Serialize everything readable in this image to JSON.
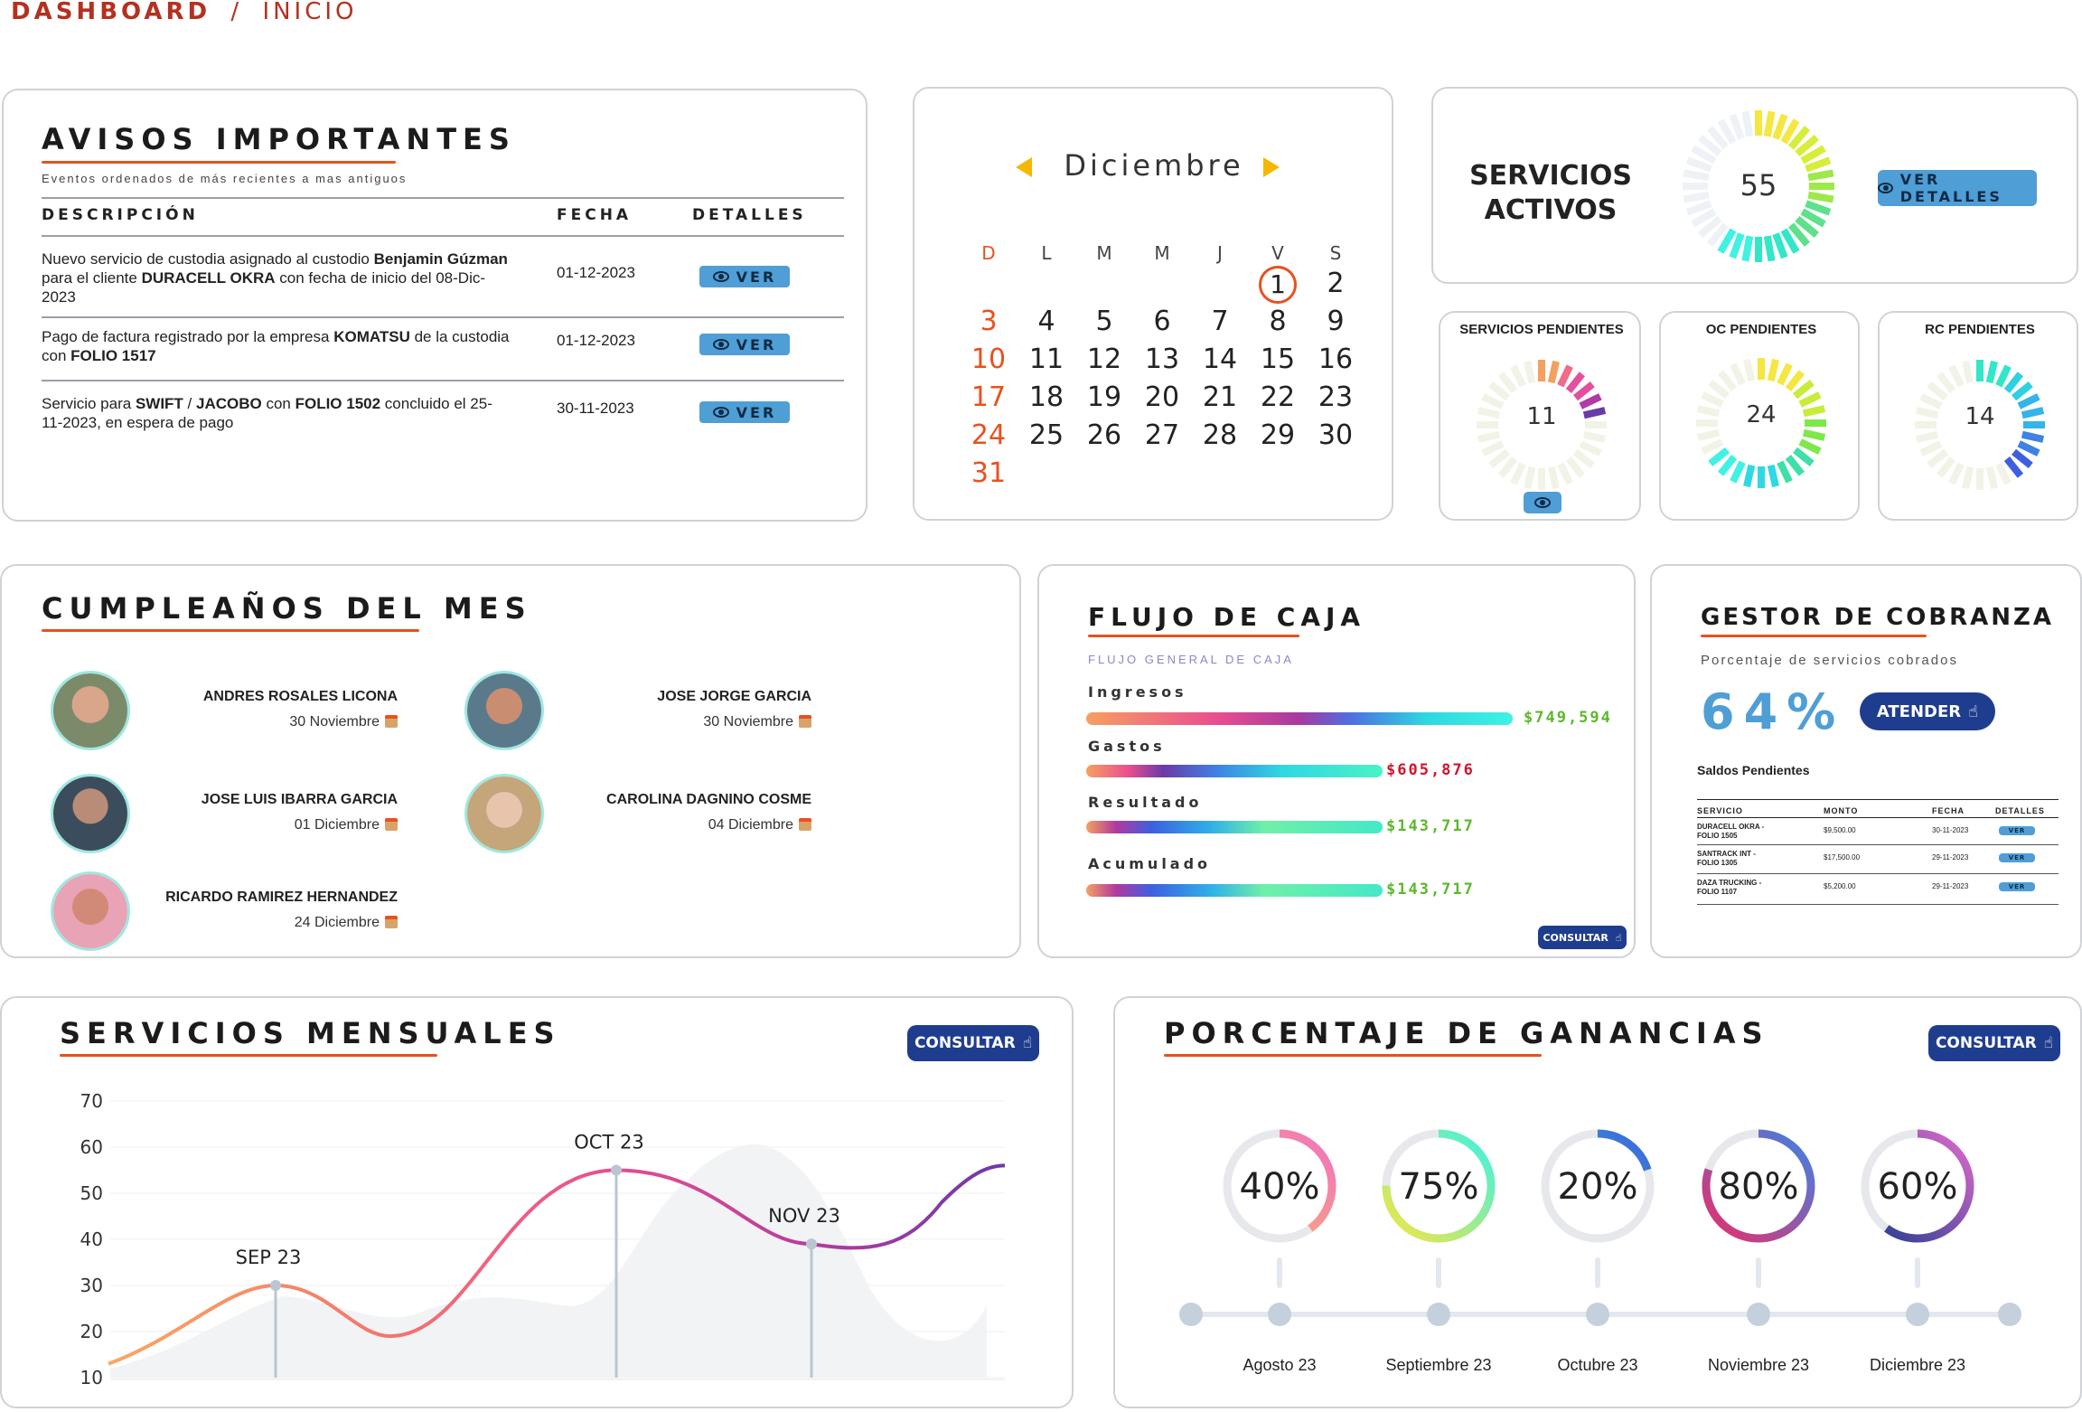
{
  "breadcrumb": {
    "section": "DASHBOARD",
    "separator": "/",
    "page": "INICIO"
  },
  "avisos": {
    "title": "AVISOS IMPORTANTES",
    "subtitle": "Eventos ordenados de más recientes a mas antiguos",
    "headers": [
      "DESCRIPCIÓN",
      "FECHA",
      "DETALLES"
    ],
    "button_label": "VER",
    "rows": [
      {
        "parts": [
          "Nuevo servicio de custodia asignado al custodio ",
          "Benjamin Gúzman",
          " para el cliente ",
          "DURACELL OKRA",
          " con fecha de inicio del  08-Dic-2023"
        ],
        "date": "01-12-2023"
      },
      {
        "parts": [
          "Pago de factura registrado por la empresa ",
          "KOMATSU",
          " de la custodia con ",
          "FOLIO 1517",
          ""
        ],
        "date": "01-12-2023"
      },
      {
        "parts": [
          "Servicio para ",
          "SWIFT",
          " / ",
          "JACOBO",
          " con ",
          "FOLIO 1502",
          " concluido el 25-11-2023, en espera de pago"
        ],
        "date": "30-11-2023"
      }
    ]
  },
  "calendar": {
    "month": "Diciembre",
    "weekdays": [
      "D",
      "L",
      "M",
      "M",
      "J",
      "V",
      "S"
    ],
    "days": [
      "1",
      "2",
      "3",
      "4",
      "5",
      "6",
      "7",
      "8",
      "9",
      "10",
      "11",
      "12",
      "13",
      "14",
      "15",
      "16",
      "17",
      "18",
      "19",
      "20",
      "21",
      "22",
      "23",
      "24",
      "25",
      "26",
      "27",
      "28",
      "29",
      "30",
      "31"
    ],
    "today": "1",
    "accent": "#e8511e",
    "arrow_color": "#f5b800"
  },
  "servicios_activos": {
    "title_line1": "SERVICIOS",
    "title_line2": "ACTIVOS",
    "value": "55",
    "button_label": "VER DETALLES"
  },
  "pendientes": [
    {
      "title": "SERVICIOS PENDIENTES",
      "value": "11"
    },
    {
      "title": "OC PENDIENTES",
      "value": "24"
    },
    {
      "title": "RC PENDIENTES",
      "value": "14"
    }
  ],
  "cumpleanos": {
    "title": "CUMPLEAÑOS DEL MES",
    "people": [
      {
        "name": "ANDRES ROSALES LICONA",
        "date": "30 Noviembre"
      },
      {
        "name": "JOSE JORGE GARCIA",
        "date": "30 Noviembre"
      },
      {
        "name": "JOSE LUIS IBARRA GARCIA",
        "date": "01 Diciembre"
      },
      {
        "name": "CAROLINA DAGNINO COSME",
        "date": "04 Diciembre"
      },
      {
        "name": "RICARDO RAMIREZ HERNANDEZ",
        "date": "24 Diciembre"
      }
    ]
  },
  "flujo": {
    "title": "FLUJO DE CAJA",
    "subtitle": "FLUJO GENERAL DE CAJA",
    "rows": [
      {
        "label": "Ingresos",
        "amount": "$749,594",
        "color": "#5cb82a"
      },
      {
        "label": "Gastos",
        "amount": "$605,876",
        "color": "#d0142c"
      },
      {
        "label": "Resultado",
        "amount": "$143,717",
        "color": "#5cb82a"
      },
      {
        "label": "Acumulado",
        "amount": "$143,717",
        "color": "#5cb82a"
      }
    ],
    "button_label": "CONSULTAR"
  },
  "cobranza": {
    "title": "GESTOR DE COBRANZA",
    "subtitle": "Porcentaje de servicios cobrados",
    "percent": "64%",
    "button_label": "ATENDER",
    "table_title": "Saldos Pendientes",
    "headers": [
      "SERVICIO",
      "MONTO",
      "FECHA",
      "DETALLES"
    ],
    "rows": [
      {
        "servicio": "DURACELL OKRA - FOLIO 1505",
        "monto": "$9,500.00",
        "fecha": "30-11-2023",
        "btn": "VER"
      },
      {
        "servicio": "SANTRACK INT - FOLIO 1305",
        "monto": "$17,500.00",
        "fecha": "29-11-2023",
        "btn": "VER"
      },
      {
        "servicio": "DAZA TRUCKING - FOLIO 1107",
        "monto": "$5,200.00",
        "fecha": "29-11-2023",
        "btn": "VER"
      }
    ]
  },
  "servicios_mensuales": {
    "title": "SERVICIOS MENSUALES",
    "button_label": "CONSULTAR",
    "chart_data": {
      "type": "line",
      "y_ticks": [
        "70",
        "60",
        "50",
        "40",
        "30",
        "20",
        "10"
      ],
      "ylim": [
        10,
        70
      ],
      "points": [
        {
          "label": "SEP 23",
          "value": 30
        },
        {
          "label": "OCT 23",
          "value": 55
        },
        {
          "label": "NOV 23",
          "value": 39
        }
      ]
    }
  },
  "ganancias": {
    "title": "PORCENTAJE DE GANANCIAS",
    "button_label": "CONSULTAR",
    "items": [
      {
        "month": "Agosto 23",
        "percent": "40%",
        "value": 0.4
      },
      {
        "month": "Septiembre 23",
        "percent": "75%",
        "value": 0.75
      },
      {
        "month": "Octubre 23",
        "percent": "20%",
        "value": 0.2
      },
      {
        "month": "Noviembre 23",
        "percent": "80%",
        "value": 0.8
      },
      {
        "month": "Diciembre 23",
        "percent": "60%",
        "value": 0.6
      }
    ]
  }
}
